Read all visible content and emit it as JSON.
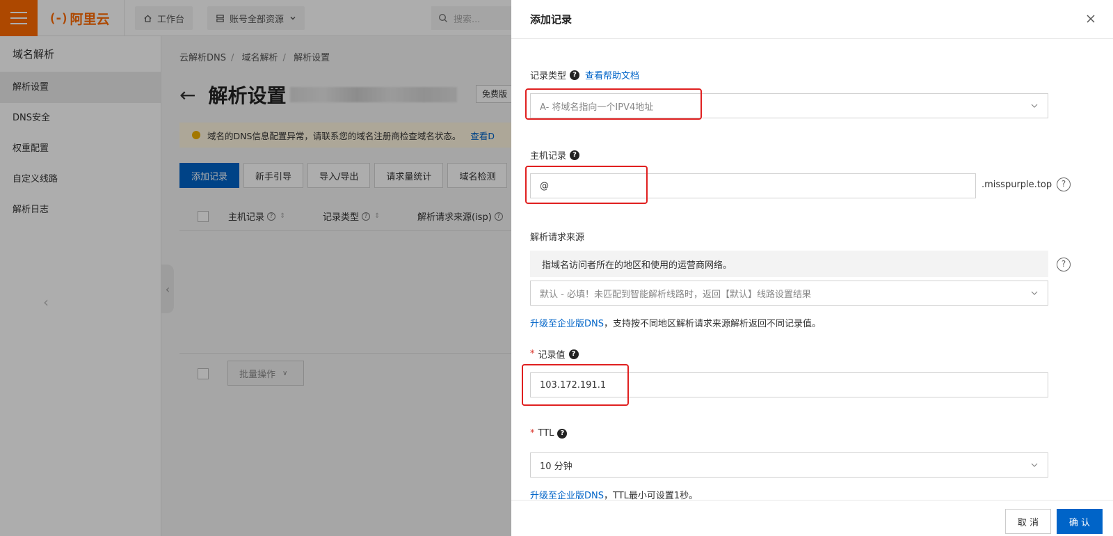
{
  "topbar": {
    "brand": "阿里云",
    "brand_mark": "(-)",
    "workbench": "工作台",
    "resources": "账号全部资源",
    "search_placeholder": "搜索..."
  },
  "sidebar": {
    "title": "域名解析",
    "items": [
      {
        "label": "解析设置",
        "active": true
      },
      {
        "label": "DNS安全"
      },
      {
        "label": "权重配置"
      },
      {
        "label": "自定义线路"
      },
      {
        "label": "解析日志"
      }
    ]
  },
  "breadcrumb": [
    "云解析DNS",
    "域名解析",
    "解析设置"
  ],
  "page": {
    "title": "解析设置",
    "edition_tag": "免费版",
    "alert_text": "域名的DNS信息配置异常，请联系您的域名注册商检查域名状态。",
    "alert_link": "查看D"
  },
  "toolbar": [
    "添加记录",
    "新手引导",
    "导入/导出",
    "请求量统计",
    "域名检测"
  ],
  "table": {
    "columns": [
      "主机记录",
      "记录类型",
      "解析请求来源(isp)"
    ],
    "batch_button": "批量操作"
  },
  "drawer": {
    "title": "添加记录",
    "record_type": {
      "label": "记录类型",
      "help_link": "查看帮助文档",
      "value": "A- 将域名指向一个IPV4地址"
    },
    "host": {
      "label": "主机记录",
      "value": "@",
      "suffix": ".misspurple.top"
    },
    "line": {
      "label": "解析请求来源",
      "info": "指域名访问者所在的地区和使用的运营商网络。",
      "value": "默认 - 必填！未匹配到智能解析线路时，返回【默认】线路设置结果",
      "upgrade_link": "升级至企业版DNS",
      "upgrade_text": "，支持按不同地区解析请求来源解析返回不同记录值。"
    },
    "value_field": {
      "label": "记录值",
      "value": "103.172.191.1"
    },
    "ttl": {
      "label": "TTL",
      "value": "10 分钟",
      "upgrade_link": "升级至企业版DNS",
      "upgrade_text": "，TTL最小可设置1秒。"
    },
    "cancel": "取 消",
    "confirm": "确 认"
  },
  "colors": {
    "brand": "#ff6a00",
    "primary": "#0064c8",
    "highlight": "#e02020"
  }
}
